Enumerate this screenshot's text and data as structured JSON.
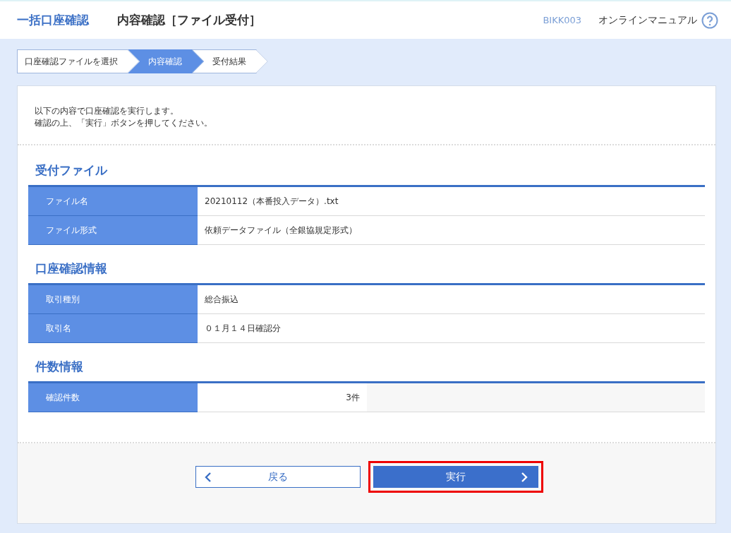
{
  "header": {
    "app_title": "一括口座確認",
    "page_title": "内容確認［ファイル受付］",
    "screen_id": "BIKK003",
    "manual_link": "オンラインマニュアル"
  },
  "steps": [
    {
      "label": "口座確認ファイルを選択",
      "selected": false
    },
    {
      "label": "内容確認",
      "selected": true
    },
    {
      "label": "受付結果",
      "selected": false
    }
  ],
  "intro": [
    "以下の内容で口座確認を実行します。",
    "確認の上、「実行」ボタンを押してください。"
  ],
  "sections": [
    {
      "title": "受付ファイル",
      "rows": [
        {
          "kind": "text",
          "label": "ファイル名",
          "value": "20210112（本番投入データ）.txt"
        },
        {
          "kind": "text",
          "label": "ファイル形式",
          "value": "依頼データファイル（全銀協規定形式）"
        }
      ]
    },
    {
      "title": "口座確認情報",
      "rows": [
        {
          "kind": "text",
          "label": "取引種別",
          "value": "総合振込"
        },
        {
          "kind": "text",
          "label": "取引名",
          "value": "０１月１４日確認分"
        }
      ]
    },
    {
      "title": "件数情報",
      "rows": [
        {
          "kind": "number",
          "label": "確認件数",
          "value": "3件"
        }
      ]
    }
  ],
  "buttons": [
    {
      "kind": "back",
      "label": "戻る",
      "highlighted": false
    },
    {
      "kind": "primary",
      "label": "実行",
      "highlighted": true
    }
  ]
}
